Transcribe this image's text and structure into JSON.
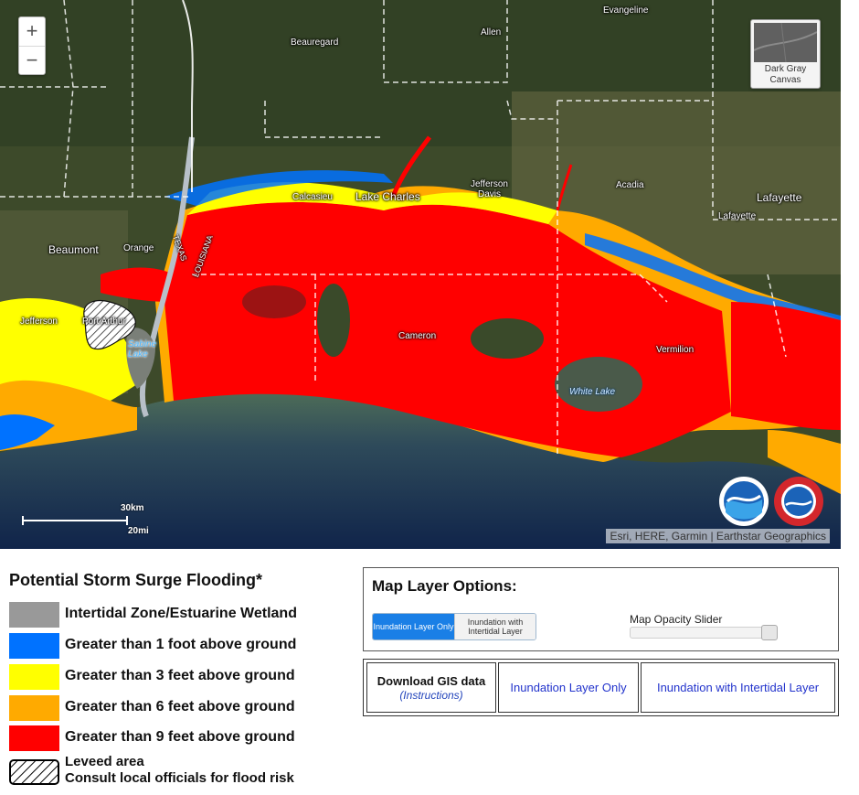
{
  "map": {
    "places": [
      {
        "name": "Evangeline",
        "cls": "place"
      },
      {
        "name": "Allen",
        "cls": "place"
      },
      {
        "name": "Beauregard",
        "cls": "place"
      },
      {
        "name": "Calcasieu",
        "cls": "place"
      },
      {
        "name": "Lake Charles",
        "cls": "place big"
      },
      {
        "name": "Jefferson\nDavis",
        "cls": "place"
      },
      {
        "name": "Acadia",
        "cls": "place"
      },
      {
        "name": "Lafayette",
        "cls": "place big"
      },
      {
        "name": "Lafayette",
        "cls": "place"
      },
      {
        "name": "Beaumont",
        "cls": "place big"
      },
      {
        "name": "Orange",
        "cls": "place"
      },
      {
        "name": "TEXAS",
        "cls": "place"
      },
      {
        "name": "LOUISIANA",
        "cls": "place"
      },
      {
        "name": "Jefferson",
        "cls": "place"
      },
      {
        "name": "Port Arthur",
        "cls": "place"
      },
      {
        "name": "Cameron",
        "cls": "place"
      },
      {
        "name": "Vermilion",
        "cls": "place"
      }
    ],
    "water_labels": [
      "Sabine\nLake",
      "White Lake"
    ],
    "zoom_in_label": "+",
    "zoom_out_label": "−",
    "basemap_label": "Dark Gray Canvas",
    "scale_km": "30km",
    "scale_mi": "20mi",
    "attribution": "Esri, HERE, Garmin | Earthstar Geographics",
    "logos": [
      "noaa-logo",
      "national-weather-service-logo"
    ]
  },
  "legend": {
    "title": "Potential Storm Surge Flooding*",
    "items": [
      {
        "label": "Intertidal Zone/Estuarine Wetland",
        "color": "#999999"
      },
      {
        "label": "Greater than 1 foot above ground",
        "color": "#0072ff"
      },
      {
        "label": "Greater than 3 feet above ground",
        "color": "#ffff00"
      },
      {
        "label": "Greater than 6 feet above ground",
        "color": "#ffaa00"
      },
      {
        "label": "Greater than 9 feet above ground",
        "color": "#ff0000"
      }
    ],
    "levee_line1": "Leveed area",
    "levee_line2": "Consult local officials for flood risk"
  },
  "options": {
    "title": "Map Layer Options:",
    "toggle_active": "Inundation Layer Only",
    "toggle_inactive": "Inundation with Intertidal Layer",
    "slider_label": "Map Opacity Slider",
    "slider_value": 1.0
  },
  "download": {
    "header": "Download GIS data",
    "instructions": "(Instructions)",
    "link1": "Inundation Layer Only",
    "link2": "Inundation with Intertidal Layer"
  }
}
